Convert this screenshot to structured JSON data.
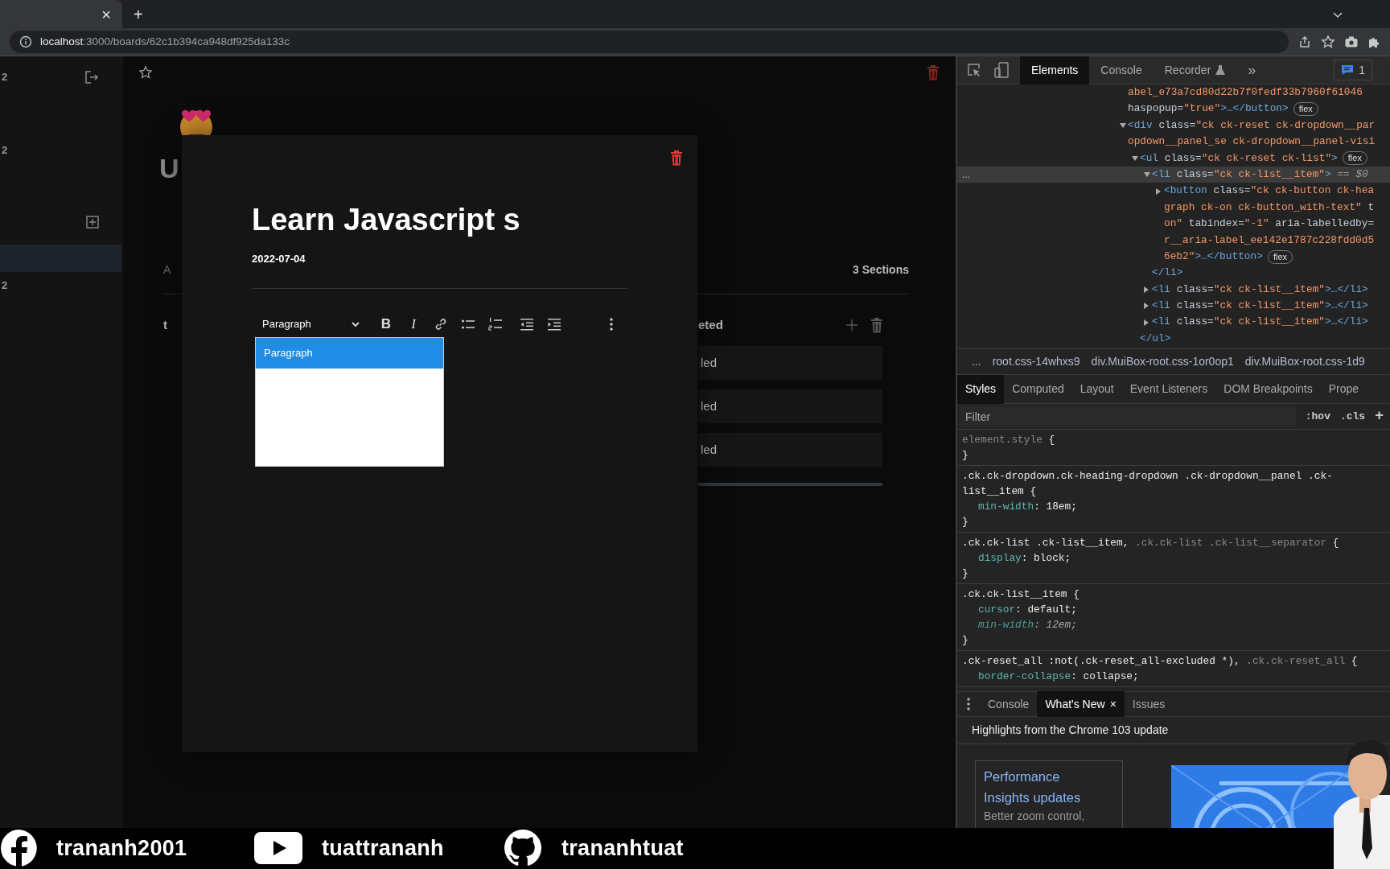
{
  "browser": {
    "tab_close": "×",
    "new_tab": "+",
    "url_host": "localhost",
    "url_path": ":3000/boards/62c1b394ca948df925da133c"
  },
  "sidebar": {
    "rows": [
      {
        "kind": "header",
        "text": "2"
      },
      {
        "kind": "label",
        "text": "2"
      },
      {
        "kind": "add"
      },
      {
        "kind": "board",
        "selected": true
      },
      {
        "kind": "label",
        "text": "2"
      }
    ]
  },
  "board": {
    "title": "U",
    "tab_label": "A",
    "sections_count": "3 Sections",
    "left_column_title": "t",
    "right_column_title": "eted",
    "cards": [
      {
        "title": "led"
      },
      {
        "title": "led"
      },
      {
        "title": "led"
      }
    ]
  },
  "modal": {
    "title": "Learn Javascript s",
    "date": "2022-07-04",
    "toolbar": {
      "heading": "Paragraph",
      "buttons": [
        {
          "kind": "bold",
          "text": "B"
        },
        {
          "kind": "italic",
          "text": "I"
        },
        {
          "kind": "link"
        },
        {
          "kind": "bulleted-list"
        },
        {
          "kind": "numbered-list"
        },
        {
          "kind": "outdent"
        },
        {
          "kind": "indent"
        },
        {
          "kind": "more"
        }
      ]
    },
    "heading_menu": [
      {
        "label": "Paragraph",
        "selected": true
      }
    ]
  },
  "devtools": {
    "tabs": [
      {
        "label": "Elements",
        "selected": true,
        "experimental": false
      },
      {
        "label": "Console",
        "selected": false,
        "experimental": false
      },
      {
        "label": "Recorder",
        "selected": false,
        "experimental": true
      }
    ],
    "more": "»",
    "messages": "1",
    "row_menu": "...",
    "tree": [
      {
        "selected": false,
        "lines": [
          [
            {
              "kind": "value",
              "text": "abel_e73a7cd80d22b7f0fedf33b7960f61046"
            }
          ],
          [
            {
              "kind": "attr",
              "text": "haspopup="
            },
            {
              "kind": "value",
              "text": "\"true\""
            },
            {
              "kind": "tag",
              "text": ">…</button>"
            }
          ]
        ],
        "badge": "flex"
      },
      {
        "selected": false,
        "expanded": true,
        "lines": [
          [
            {
              "kind": "tag",
              "text": "<div"
            },
            {
              "kind": "attr",
              "text": " class="
            },
            {
              "kind": "value",
              "text": "\"ck ck-reset ck-dropdown__par"
            }
          ],
          [
            {
              "kind": "value",
              "text": "opdown__panel_se ck-dropdown__panel-visi"
            }
          ]
        ],
        "children": [
          {
            "selected": false,
            "expanded": true,
            "lines": [
              [
                {
                  "kind": "tag",
                  "text": "<ul"
                },
                {
                  "kind": "attr",
                  "text": " class="
                },
                {
                  "kind": "value",
                  "text": "\"ck ck-reset ck-list\""
                },
                {
                  "kind": "tag",
                  "text": ">"
                }
              ]
            ],
            "badge": "flex",
            "close": [
              {
                "kind": "tag",
                "text": "</ul>"
              }
            ],
            "children": [
              {
                "selected": true,
                "expanded": true,
                "lines": [
                  [
                    {
                      "kind": "tag",
                      "text": "<li"
                    },
                    {
                      "kind": "attr",
                      "text": " class="
                    },
                    {
                      "kind": "value",
                      "text": "\"ck ck-list__item\""
                    },
                    {
                      "kind": "tag",
                      "text": ">"
                    }
                  ]
                ],
                "suffix": "== $0",
                "close": [
                  {
                    "kind": "tag",
                    "text": "</li>"
                  }
                ],
                "children": [
                  {
                    "selected": false,
                    "expanded": false,
                    "lines": [
                      [
                        {
                          "kind": "tag",
                          "text": "<button"
                        },
                        {
                          "kind": "attr",
                          "text": " class="
                        },
                        {
                          "kind": "value",
                          "text": "\"ck ck-button ck-hea"
                        }
                      ],
                      [
                        {
                          "kind": "value",
                          "text": "graph ck-on ck-button_with-text\""
                        },
                        {
                          "kind": "attr",
                          "text": " t"
                        }
                      ],
                      [
                        {
                          "kind": "value",
                          "text": "on\""
                        },
                        {
                          "kind": "attr",
                          "text": " tabindex="
                        },
                        {
                          "kind": "value",
                          "text": "\"-1\""
                        },
                        {
                          "kind": "attr",
                          "text": " aria-labelledby="
                        }
                      ],
                      [
                        {
                          "kind": "value",
                          "text": "r__aria-label_ee142e1787c228fdd0d5"
                        }
                      ],
                      [
                        {
                          "kind": "value",
                          "text": "6eb2\""
                        },
                        {
                          "kind": "tag",
                          "text": ">…</button>"
                        }
                      ]
                    ],
                    "badge": "flex"
                  }
                ]
              },
              {
                "selected": false,
                "expanded": false,
                "lines": [
                  [
                    {
                      "kind": "tag",
                      "text": "<li"
                    },
                    {
                      "kind": "attr",
                      "text": " class="
                    },
                    {
                      "kind": "value",
                      "text": "\"ck ck-list__item\""
                    },
                    {
                      "kind": "tag",
                      "text": ">…</li>"
                    }
                  ]
                ]
              },
              {
                "selected": false,
                "expanded": false,
                "lines": [
                  [
                    {
                      "kind": "tag",
                      "text": "<li"
                    },
                    {
                      "kind": "attr",
                      "text": " class="
                    },
                    {
                      "kind": "value",
                      "text": "\"ck ck-list__item\""
                    },
                    {
                      "kind": "tag",
                      "text": ">…</li>"
                    }
                  ]
                ]
              },
              {
                "selected": false,
                "expanded": false,
                "lines": [
                  [
                    {
                      "kind": "tag",
                      "text": "<li"
                    },
                    {
                      "kind": "attr",
                      "text": " class="
                    },
                    {
                      "kind": "value",
                      "text": "\"ck ck-list__item\""
                    },
                    {
                      "kind": "tag",
                      "text": ">…</li>"
                    }
                  ]
                ]
              }
            ]
          }
        ]
      }
    ],
    "breadcrumbs": {
      "overflow": "...",
      "items": [
        "root.css-14whxs9",
        "div.MuiBox-root.css-1or0op1",
        "div.MuiBox-root.css-1d9"
      ]
    },
    "style_tabs": [
      {
        "label": "Styles",
        "selected": true
      },
      {
        "label": "Computed",
        "selected": false
      },
      {
        "label": "Layout",
        "selected": false
      },
      {
        "label": "Event Listeners",
        "selected": false
      },
      {
        "label": "DOM Breakpoints",
        "selected": false
      },
      {
        "label": "Prope",
        "selected": false
      }
    ],
    "filter": {
      "placeholder": "Filter",
      "hov": ":hov",
      "cls": ".cls",
      "add": "+"
    },
    "rules": [
      {
        "selectors": [
          {
            "text": "element.style",
            "matched": false
          }
        ],
        "open": " {",
        "close": "}"
      },
      {
        "selectors": [
          {
            "text": ".ck.ck-dropdown.ck-heading-dropdown .ck-dropdown__panel .ck-list__item",
            "matched": true
          }
        ],
        "open": " {",
        "close": "}",
        "declarations": [
          {
            "property": "min-width",
            "value": ": 18em;",
            "overridden": false
          }
        ]
      },
      {
        "selectors": [
          {
            "text": ".ck.ck-list .ck-list__item,",
            "matched": true
          },
          {
            "text": ".ck.ck-list .ck-list__separator",
            "matched": false
          }
        ],
        "open": " {",
        "close": "}",
        "declarations": [
          {
            "property": "display",
            "value": ": block;",
            "overridden": false
          }
        ]
      },
      {
        "selectors": [
          {
            "text": ".ck.ck-list__item",
            "matched": true
          }
        ],
        "open": " {",
        "close": "}",
        "declarations": [
          {
            "property": "cursor",
            "value": ": default;",
            "overridden": false
          },
          {
            "property": "min-width",
            "value": ": 12em;",
            "overridden": true
          }
        ]
      },
      {
        "selectors": [
          {
            "text": ".ck-reset_all :not(.ck-reset_all-excluded *),",
            "matched": true
          },
          {
            "text": ".ck.ck-reset_all",
            "matched": false
          }
        ],
        "open": " {",
        "declarations": [
          {
            "property": "border-collapse",
            "value": ": collapse;",
            "overridden": false
          }
        ]
      }
    ],
    "drawer_tabs": [
      {
        "label": "Console",
        "selected": false
      },
      {
        "label": "What's New",
        "selected": true,
        "close": "×"
      },
      {
        "label": "Issues",
        "selected": false
      }
    ],
    "whats_new": {
      "heading": "Highlights from the Chrome 103 update",
      "links": [
        "Performance",
        "Insights updates"
      ],
      "description": "Better zoom control,"
    }
  },
  "banner": [
    {
      "kind": "facebook",
      "handle": "trananh2001"
    },
    {
      "kind": "youtube",
      "handle": "tuattrananh"
    },
    {
      "kind": "github",
      "handle": "trananhtuat"
    }
  ]
}
